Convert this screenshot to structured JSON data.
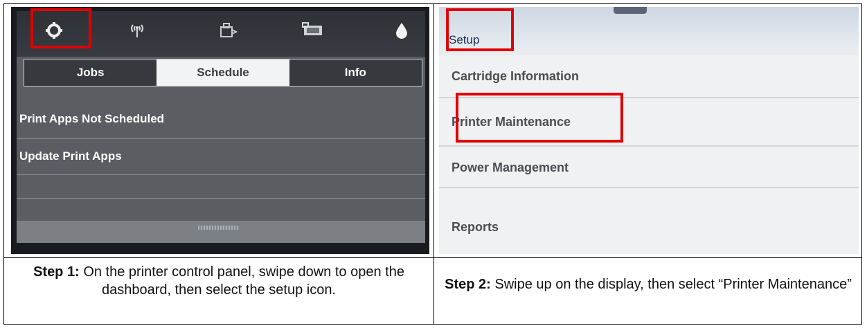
{
  "left": {
    "tabs": [
      "Jobs",
      "Schedule",
      "Info"
    ],
    "items": [
      "Print Apps Not Scheduled",
      "Update Print Apps"
    ],
    "top_icons": [
      "gear-icon",
      "wireless-icon",
      "web-services-icon",
      "network-icon",
      "ink-drop-icon"
    ],
    "caption_label": "Step 1:",
    "caption_text": "On the printer control panel, swipe down to open the dashboard, then select the setup icon."
  },
  "right": {
    "title": "Setup",
    "items": [
      "Cartridge Information",
      "Printer Maintenance",
      "Power Management",
      "Reports"
    ],
    "caption_label": "Step 2:",
    "caption_text": "Swipe up on the display, then select “Printer Maintenance”"
  },
  "colors": {
    "highlight": "#e00000",
    "dark_panel": "#383b41",
    "light_panel": "#f0f1f3"
  }
}
